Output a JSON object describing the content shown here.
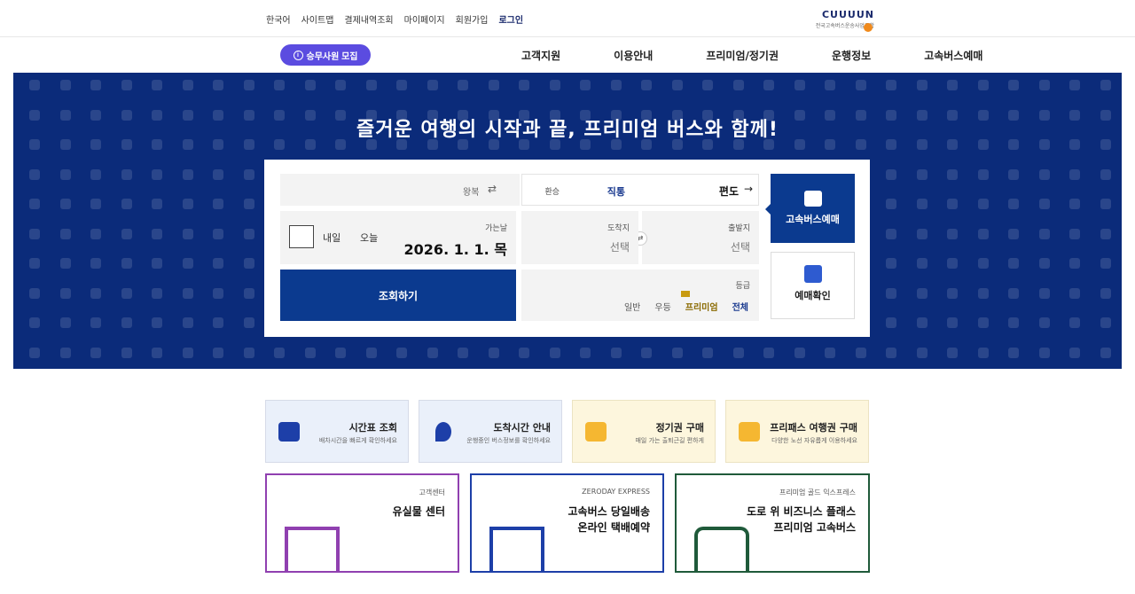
{
  "header": {
    "logo_text": "CUUUUN",
    "logo_sub": "전국고속버스운송사업조합",
    "utility_links": [
      "로그인",
      "회원가입",
      "마이페이지",
      "결제내역조회",
      "사이트맵",
      "한국어"
    ],
    "recruit_label": "승무사원 모집",
    "nav": [
      "고속버스예매",
      "운행정보",
      "프리미엄/정기권",
      "이용안내",
      "고객지원"
    ]
  },
  "hero": {
    "title": "즐거운 여행의 시작과 끝, 프리미엄 버스와 함께!"
  },
  "booking": {
    "tab_express": "고속버스예매",
    "tab_reserve": "예매확인",
    "trip_oneway": "편도",
    "trip_select_label": "직통",
    "trip_select_caption": "환승",
    "return_label": "왕복",
    "departure_caption": "출발지",
    "departure_value": "선택",
    "arrival_caption": "도착지",
    "arrival_value": "선택",
    "date_caption": "가는날",
    "date_value": "2026. 1. 1. 목",
    "today_label": "오늘",
    "tomorrow_label": "내일",
    "grade_caption": "등급",
    "grade_options": [
      "전체",
      "프리미엄",
      "우등",
      "일반"
    ],
    "search_button": "조회하기"
  },
  "quick": [
    {
      "title": "프리패스 여행권 구매",
      "desc": "다양한 노선 자유롭게 이용하세요"
    },
    {
      "title": "정기권 구매",
      "desc": "매일 가는 출퇴근길 편하게"
    },
    {
      "title": "도착시간 안내",
      "desc": "운행중인 버스정보를 확인하세요"
    },
    {
      "title": "시간표 조회",
      "desc": "배차시간을 빠르게 확인하세요"
    }
  ],
  "cards": [
    {
      "sub": "프리미엄 골드 익스프레스",
      "title1": "도로 위 비즈니스 플래스",
      "title2": "프리미엄 고속버스"
    },
    {
      "sub": "ZERODAY EXPRESS",
      "title1": "고속버스 당일배송",
      "title2": "온라인 택배예약"
    },
    {
      "sub": "고객센터",
      "title1": "유실물 센터",
      "title2": ""
    }
  ]
}
